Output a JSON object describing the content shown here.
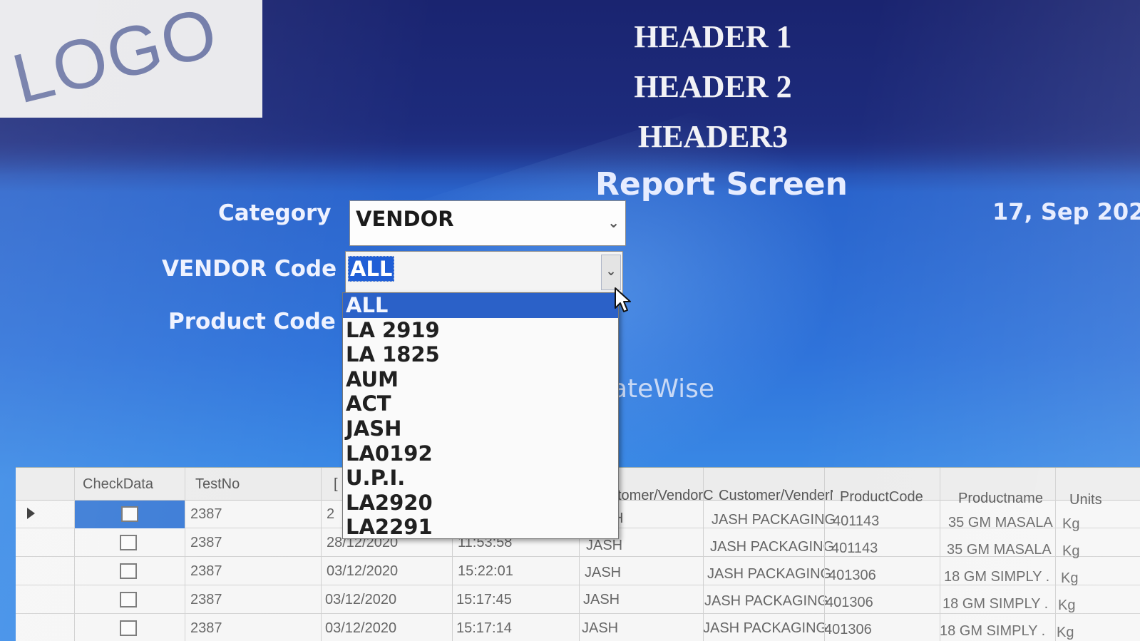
{
  "logo": {
    "text": "LOGO"
  },
  "headers": {
    "h1": "HEADER 1",
    "h2": "HEADER 2",
    "h3": "HEADER3"
  },
  "report": {
    "title": "Report Screen",
    "date": "17, Sep 202"
  },
  "form": {
    "category_label": "Category",
    "category_value": "VENDOR",
    "vendor_code_label": "VENDOR Code",
    "vendor_code_value": "ALL",
    "product_code_label": "Product Code",
    "datewise_text": "ateWise"
  },
  "dropdown": {
    "options": [
      "ALL",
      "LA 2919",
      "LA 1825",
      "AUM",
      "ACT",
      "JASH",
      "LA0192",
      "U.P.I.",
      "LA2920",
      "LA2291"
    ],
    "selected": "ALL"
  },
  "grid": {
    "columns": {
      "checkdata": "CheckData",
      "testno": "TestNo",
      "date": "[",
      "customer_vendor_code": "stomer/VendorC",
      "customer_vendor_name": "Customer/VenderN",
      "productcode": "ProductCode",
      "productname": "Productname",
      "units": "Units"
    },
    "rows": [
      {
        "testno": "2387",
        "date": "2",
        "time": "",
        "code": "H",
        "name": "JASH PACKAGING",
        "productcode": "401143",
        "productname": "35 GM MASALA ...",
        "units": "Kg"
      },
      {
        "testno": "2387",
        "date": "28/12/2020",
        "time": "11:53:58",
        "code": "JASH",
        "name": "JASH PACKAGING",
        "productcode": "401143",
        "productname": "35 GM MASALA ...",
        "units": "Kg"
      },
      {
        "testno": "2387",
        "date": "03/12/2020",
        "time": "15:22:01",
        "code": "JASH",
        "name": "JASH PACKAGING",
        "productcode": "401306",
        "productname": "18 GM SIMPLY ...",
        "units": "Kg"
      },
      {
        "testno": "2387",
        "date": "03/12/2020",
        "time": "15:17:45",
        "code": "JASH",
        "name": "JASH PACKAGING",
        "productcode": "401306",
        "productname": "18 GM SIMPLY ...",
        "units": "Kg"
      },
      {
        "testno": "2387",
        "date": "03/12/2020",
        "time": "15:17:14",
        "code": "JASH",
        "name": "JASH PACKAGING",
        "productcode": "401306",
        "productname": "18 GM SIMPLY ...",
        "units": "Kg"
      }
    ]
  },
  "colors": {
    "header_band": "#1d2b7c",
    "selection": "#2b61c8",
    "background": "#2f73da"
  },
  "icons": {
    "combo_chevron": "chevron-down-icon",
    "cursor": "mouse-pointer-icon",
    "row_pointer": "row-pointer-icon"
  }
}
